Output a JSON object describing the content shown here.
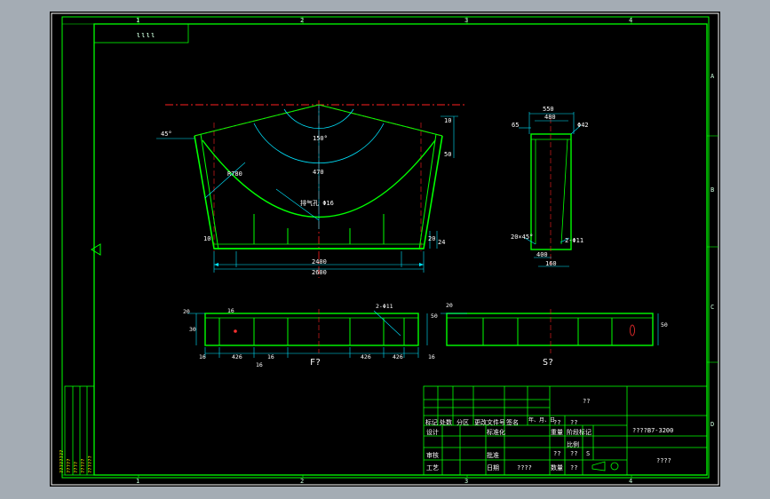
{
  "border": {
    "top_numbers": [
      "1",
      "2",
      "3",
      "4"
    ],
    "bottom_numbers": [
      "1",
      "2",
      "3",
      "4"
    ],
    "side_letters": [
      "A",
      "B",
      "C",
      "D"
    ],
    "corner_code": "ιιιι"
  },
  "front_view": {
    "angle_left": "45°",
    "angle_center": "150°",
    "radius": "R780",
    "arc_label": "470",
    "vent_label": "排气孔 Φ16",
    "width_inner": "2400",
    "width_outer": "2600",
    "dim_right_top": "10",
    "dim_right_mid": "50",
    "dim_bottom_a": "20",
    "dim_bottom_b": "24",
    "dim_left": "10"
  },
  "side_view": {
    "dim_top_outer": "550",
    "dim_top_inner": "480",
    "dim_left": "65",
    "dim_right": "Φ42",
    "chamfer": "20×45°",
    "hole": "2-Φ11",
    "dim_bottom_a": "400",
    "dim_bottom_b": "160"
  },
  "bottom_front": {
    "view_label": "F?",
    "holes": "2-Φ11",
    "dims": [
      "16",
      "426",
      "16",
      "426",
      "426",
      "16"
    ],
    "dim_left_a": "20",
    "dim_left_b": "30",
    "dim_left_c": "16",
    "dim_right": "50",
    "dim_sub": "16"
  },
  "bottom_side": {
    "view_label": "S?",
    "dim_top": "20",
    "dim_right": "50"
  },
  "title_block": {
    "top_right_cell": "??",
    "row_headers": [
      "标记",
      "处数",
      "分区",
      "更改文件号",
      "签名",
      "年、月、日"
    ],
    "roles": [
      "设计",
      "审核",
      "工艺"
    ],
    "std_label": "标准化",
    "approve_label": "批准",
    "date_label": "日期",
    "date_value": "????",
    "stage_label": "阶段标记",
    "weight_label": "重量",
    "scale_label": "比例",
    "count_label": "数量",
    "small_vals": [
      "??",
      "??",
      "??",
      "??",
      "S"
    ],
    "drawing_no": "????B7-3200",
    "drawing_name": "????",
    "symbol_label": "??",
    "left_strip": [
      "????????",
      "?????",
      "????",
      "?????",
      "??????"
    ]
  }
}
